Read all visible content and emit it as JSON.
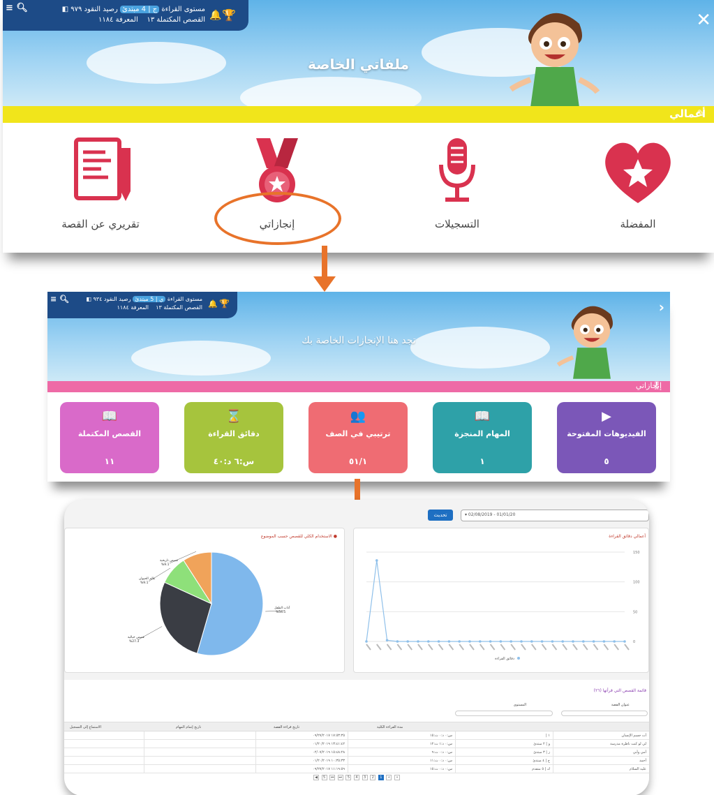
{
  "panel1": {
    "status": {
      "reading_level_label": "مستوى القراءة",
      "reading_level_value": "ج | 4 مبتدئ",
      "balance_label": "رصيد النقود",
      "balance_value": "٩٧٩",
      "completed_label": "القصص المكتملة",
      "completed_value": "١٣",
      "knowledge_label": "المعرفة",
      "knowledge_value": "١١٨٤"
    },
    "title": "ملفاتي الخاصة",
    "section_label": "أعمالي",
    "tiles": [
      {
        "label": "المفضلة",
        "icon": "heart-star-icon"
      },
      {
        "label": "التسجيلات",
        "icon": "microphone-icon"
      },
      {
        "label": "إنجازاتي",
        "icon": "medal-icon"
      },
      {
        "label": "تقريري عن القصة",
        "icon": "report-pencil-icon"
      }
    ],
    "colors": {
      "accent_bar": "#f1e51b",
      "highlight_ring": "#e8732a",
      "tile_red": "#d9324f"
    }
  },
  "panel2": {
    "status": {
      "reading_level_label": "مستوى القراءة",
      "reading_level_value": "ي | 5 مبتدئ",
      "balance_label": "رصيد النقود",
      "balance_value": "٩٣٤",
      "completed_label": "القصص المكتملة",
      "completed_value": "١٣",
      "knowledge_label": "المعرفة",
      "knowledge_value": "١١٨٤"
    },
    "title": "تجد هنا الإنجازات الخاصة بك",
    "section_label": "إنجازاتي",
    "stats": [
      {
        "label": "الفيديوهات المفتوحة",
        "value": "٥",
        "icon": "play-icon",
        "color": "#7b57b8"
      },
      {
        "label": "المهام المنجزة",
        "value": "١",
        "icon": "book-check-icon",
        "color": "#2ea1a8"
      },
      {
        "label": "ترتيبي في الصف",
        "value": "٥١/١",
        "icon": "class-rank-icon",
        "color": "#ef6c73"
      },
      {
        "label": "دقائق القراءة",
        "value": "س:٦ د:٤٠",
        "icon": "hourglass-icon",
        "color": "#a6c43d"
      },
      {
        "label": "القصص المكتملة",
        "value": "١١",
        "icon": "open-book-icon",
        "color": "#d96ac9"
      }
    ],
    "colors": {
      "accent_bar": "#ee6aa6"
    }
  },
  "panel3": {
    "date_range": "02/08/2019 - 01/01/20",
    "update_label": "تحديث",
    "line_title": "أعمالي دقائق القراءة",
    "pie_title": "الاستخدام الكلي للقصص حسب الموضوع",
    "legend_label": "دقائق القراءة",
    "table_title": "قائمة القصص التي قرأتها (٢٦)",
    "columns": [
      "عنوان القصة",
      "المستوى",
      "مدة القراءة الكلية",
      "تاريخ قراءة القصة",
      "تاريخ إتمام المهام",
      "الاستماع إلى التسجيل"
    ],
    "rows": [
      {
        "title": "أت جسم الإنسان",
        "level": "١ |",
        "duration": "س:٠ د:٠ ث:١٥",
        "date": "١٧:٥٣:٣٥ ٠٩/٢٧/٢٠١٧"
      },
      {
        "title": "لي لو كنت ناظرة مدرسة",
        "level": "و | ٢ مبتدئ",
        "duration": "س:٠ د:١ ث:١٢",
        "date": "١٣:٤١:٤٢ ٠١/٢٠/٢٠١٩"
      },
      {
        "title": "أمي وأبي",
        "level": "ز | ٣ مبتدئ",
        "duration": "س:٠ د:٠ ث:٩",
        "date": "١٥:٤٨:٢٨ ٠٢/٠٧/٢٠١٩"
      },
      {
        "title": "أحمد",
        "level": "ج | ٤ مبتدئ",
        "duration": "س:٠ د:٠ ث:١١",
        "date": "١٠:٣٥:٣٣ ٠١/٢٠/٢٠١٩"
      },
      {
        "title": "عليه السلام",
        "level": "ك | ٥ متقدم",
        "duration": "س:٠ د:٠ ث:١٥",
        "date": "١١:١٩:٥٩ ٠٩/٢٧/٢٠١٧"
      }
    ],
    "pager": [
      "◀",
      "5",
      "⏮",
      "⏭",
      "5",
      "4",
      "3",
      "2",
      "1",
      "«",
      "»"
    ]
  },
  "chart_data": [
    {
      "type": "line",
      "title": "أعمالي دقائق القراءة",
      "ylim": [
        0,
        150
      ],
      "yticks": [
        0,
        50,
        100,
        150
      ],
      "series": [
        {
          "name": "دقائق القراءة",
          "values": [
            0,
            136,
            2,
            0,
            0,
            0,
            0,
            0,
            0,
            0,
            0,
            0,
            0,
            0,
            0,
            0,
            0,
            0,
            0,
            0,
            0,
            0,
            0,
            0,
            0,
            0
          ]
        }
      ],
      "color": "#8fc0ea"
    },
    {
      "type": "pie",
      "title": "الاستخدام الكلي للقصص حسب الموضوع",
      "slices": [
        {
          "label": "آداب الطفل",
          "value": 54.5,
          "color": "#7fb8ec"
        },
        {
          "label": "قصص خيالية",
          "value": 27.3,
          "color": "#3a3d44"
        },
        {
          "label": "عالم الحيوان",
          "value": 9.1,
          "color": "#8ee07a"
        },
        {
          "label": "قصص تاريخية",
          "value": 9.1,
          "color": "#f0a35a"
        }
      ],
      "labels_text": [
        "%54.5",
        "%27.3",
        "%9.1",
        "%9.1"
      ]
    }
  ]
}
